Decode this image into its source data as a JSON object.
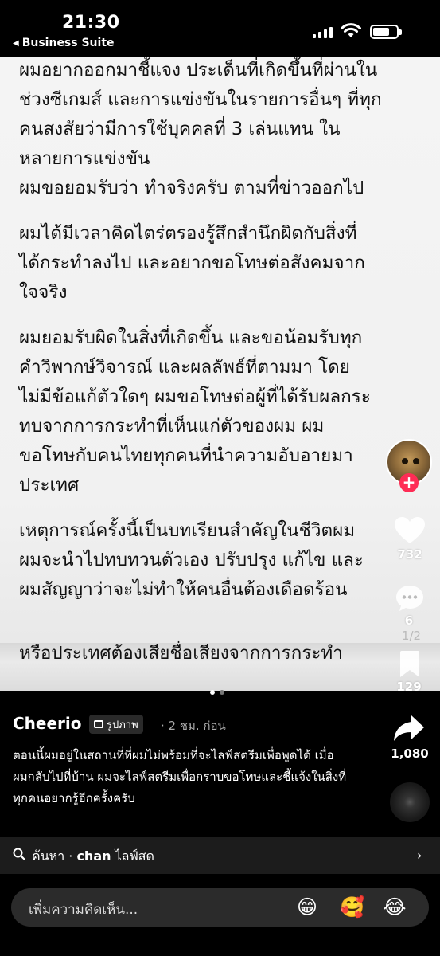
{
  "status_bar": {
    "time": "21:30",
    "back_app": "Business Suite"
  },
  "statement": {
    "lines": [
      "ผมอยากออกมาชี้แจง ประเด็นที่เกิดขึ้นที่ผ่านใน",
      "ช่วงซีเกมส์ และการแข่งขันในรายการอื่นๆ ที่ทุก",
      "คนสงสัยว่ามีการใช้บุคคลที่ 3 เล่นแทน ใน",
      "หลายการแข่งขัน",
      "ผมขอยอมรับว่า ทำจริงครับ ตามที่ข่าวออกไป",
      "ผมได้มีเวลาคิดไตร่ตรองรู้สึกสำนึกผิดกับสิ่งที่",
      "ได้กระทำลงไป และอยากขอโทษต่อสังคมจาก",
      "ใจจริง",
      "ผมยอมรับผิดในสิ่งที่เกิดขึ้น และขอน้อมรับทุก",
      "คำวิพากษ์วิจารณ์ และผลลัพธ์ที่ตามมา โดย",
      "ไม่มีข้อแก้ตัวใดๆ ผมขอโทษต่อผู้ที่ได้รับผลกระ",
      "ทบจากการกระทำที่เห็นแก่ตัวของผม ผม",
      "ขอโทษกับคนไทยทุกคนที่นำความอับอายมา",
      "ประเทศ",
      "เหตุการณ์ครั้งนี้เป็นบทเรียนสำคัญในชีวิตผม",
      "ผมจะนำไปทบทวนตัวเอง ปรับปรุง แก้ไข และ",
      "ผมสัญญาว่าจะไม่ทำให้คนอื่นต้องเดือดร้อน",
      "หรือประเทศต้องเสียชื่อเสียงจากการกระทำ"
    ]
  },
  "rail": {
    "likes": "732",
    "comments": "6",
    "page_indicator": "1/2",
    "saves": "129",
    "shares": "1,080"
  },
  "post": {
    "author": "Cheerio",
    "type_label": "รูปภาพ",
    "posted": "· 2 ชม. ก่อน",
    "caption": "ตอนนี้ผมอยู่ในสถานที่ที่ผมไม่พร้อมที่จะไลฟ์สตรีมเพื่อพูดได้ เมื่อผมกลับไปที่บ้าน ผมจะไลฟ์สตรีมเพื่อกราบขอโทษและชี้แจ้งในสิ่งที่ทุกคนอยากรู้อีกครั้งครับ"
  },
  "search": {
    "prefix": "ค้นหา · ",
    "query_bold": "chan",
    "query_rest": " ไลฟ์สด"
  },
  "comment": {
    "placeholder": "เพิ่มความคิดเห็น...",
    "emojis": [
      "😁",
      "🥰",
      "😂"
    ]
  },
  "colors": {
    "follow_accent": "#fe2c55",
    "background": "#000000",
    "photo_paper": "#f2f2f2"
  }
}
